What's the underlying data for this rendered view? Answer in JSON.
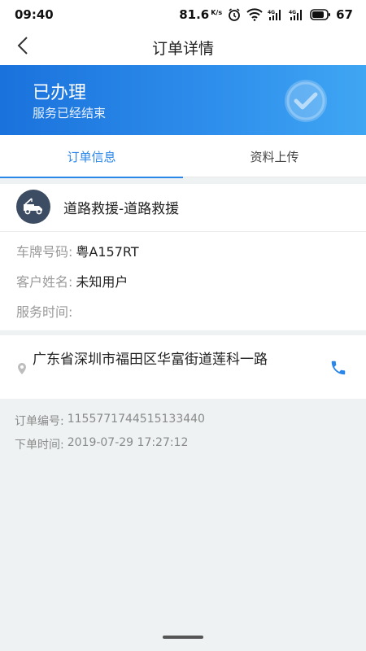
{
  "status_bar": {
    "time": "09:40",
    "net_speed": "81.6",
    "net_speed_unit": "K/s",
    "battery": "67"
  },
  "nav": {
    "title": "订单详情"
  },
  "banner": {
    "status": "已办理",
    "subtitle": "服务已经结束",
    "color_start": "#1a72dc",
    "color_end": "#3fa6f3"
  },
  "tabs": [
    {
      "label": "订单信息",
      "active": true
    },
    {
      "label": "资料上传",
      "active": false
    }
  ],
  "service": {
    "name": "道路救援-道路救援",
    "icon": "tow-truck-icon"
  },
  "details": {
    "plate_label": "车牌号码:",
    "plate_value": "粤A157RT",
    "customer_label": "客户姓名:",
    "customer_value": "未知用户",
    "time_label": "服务时间:",
    "time_value": ""
  },
  "location": {
    "address": "广东省深圳市福田区华富街道莲科一路",
    "icon": "location-pin-icon",
    "action_icon": "phone-icon"
  },
  "order_meta": {
    "number_label": "订单编号:",
    "number_value": "1155771744515133440",
    "created_label": "下单时间:",
    "created_value": "2019-07-29 17:27:12"
  },
  "accent_color": "#2a86e8"
}
